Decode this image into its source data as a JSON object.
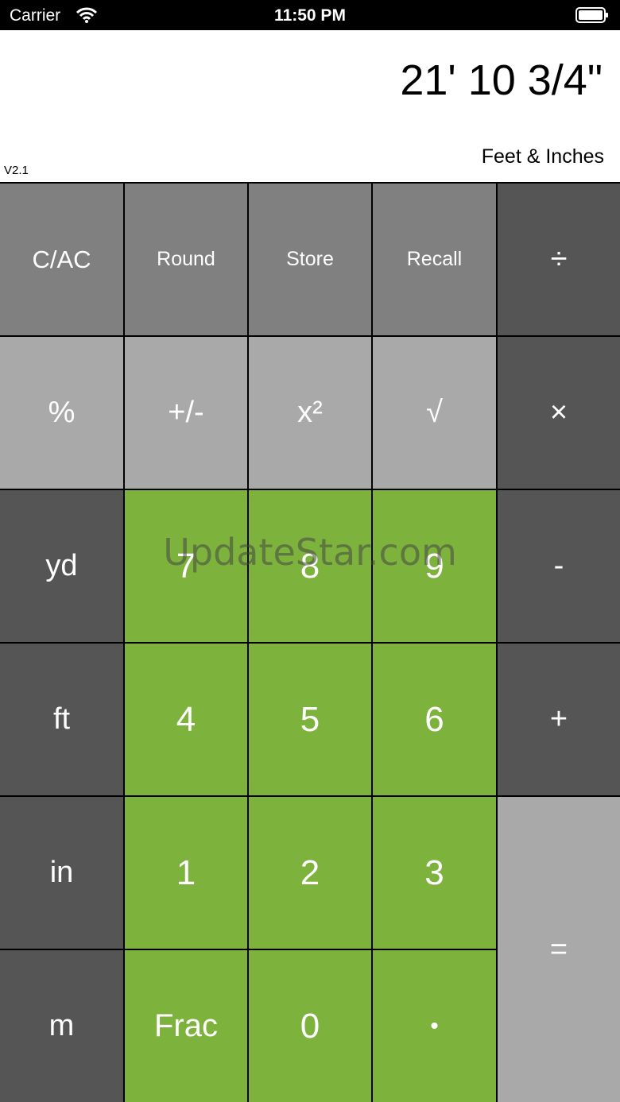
{
  "status_bar": {
    "carrier": "Carrier",
    "time": "11:50 PM"
  },
  "display": {
    "value": "21' 10 3/4\"",
    "mode": "Feet & Inches",
    "version": "V2.1"
  },
  "keys": {
    "clear": "C/AC",
    "round": "Round",
    "store": "Store",
    "recall": "Recall",
    "divide": "÷",
    "percent": "%",
    "plus_minus": "+/-",
    "square": "x²",
    "sqrt": "√",
    "multiply": "×",
    "yd": "yd",
    "seven": "7",
    "eight": "8",
    "nine": "9",
    "minus": "-",
    "ft": "ft",
    "four": "4",
    "five": "5",
    "six": "6",
    "plus": "+",
    "in": "in",
    "one": "1",
    "two": "2",
    "three": "3",
    "equals": "=",
    "m": "m",
    "frac": "Frac",
    "zero": "0",
    "decimal": "•"
  },
  "watermark": "UpdateStar.com",
  "colors": {
    "top_row": "#808080",
    "light_row": "#a9a9a9",
    "dark": "#555555",
    "green": "#7db33c"
  }
}
